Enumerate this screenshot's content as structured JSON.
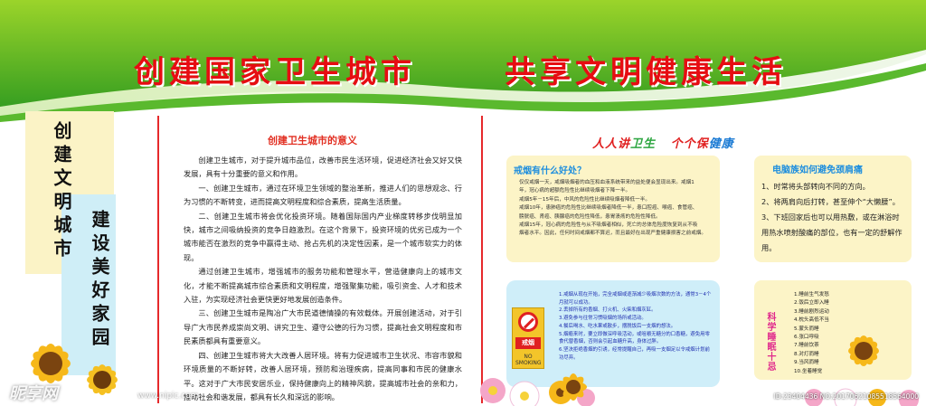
{
  "header": {
    "headline_left": "创建国家卫生城市",
    "headline_right": "共享文明健康生活"
  },
  "left_banner": {
    "col1": "创建文明城市",
    "col2": "建设美好家园"
  },
  "meaning": {
    "title": "创建卫生城市的意义",
    "paragraphs": [
      "创建卫生城市，对于提升城市品位，改善市民生活环境，促进经济社会又好又快发展，具有十分重要的意义和作用。",
      "一、创建卫生城市，通过在环境卫生领域的整治革新，推进人们的思想观念、行为习惯的不断转变，进而提高文明程度和综合素质，提高生活质量。",
      "二、创建卫生城市将会优化投资环境。随着国际国内产业梯度转移步伐明显加快，城市之间吸纳投资的竞争日趋激烈。在这个背景下，投资环境的优劣已成为一个城市能否在激烈的竞争中赢得主动、抢占先机的决定性因素，是一个城市软实力的体现。",
      "通过创建卫生城市，增强城市的服务功能和管理水平，营造健康向上的城市文化，才能不断提高城市综合素质和文明程度，增强聚集功能，吸引资金、人才和技术入驻，为实现经济社会更快更好地发展创造条件。",
      "三、创建卫生城市是陶冶广大市民道德情操的有效载体。开展创建活动，对于引导广大市民养成崇尚文明、讲究卫生、遵守公德的行为习惯，提高社会文明程度和市民素质都具有重要意义。",
      "四、创建卫生城市将大大改善人居环境。将有力促进城市卫生状况、市容市貌和环境质量的不断好转，改善人居环境，预防和治理疾病，提高同事和市民的健康水平。这对于广大市民安居乐业，保持健康向上的精神风貌，提高城市社会的亲和力，推动社会和谐发展，都具有长久和深远的影响。"
    ]
  },
  "slogan": {
    "part1": "人人讲",
    "part2": "卫生",
    "part3": "个个保",
    "part4": "健康"
  },
  "quit_smoking": {
    "title": "戒烟有什么好处？",
    "lines": [
      "仅仅戒烟一天，戒烟吸烟者的血压和血液系统带来的益处便会显现出来。戒烟1",
      "年，冠心病的超额危险性比继续吸烟者下降一半。",
      "戒烟5年－15年后，中风的危险性比继续吸烟者降低一半。",
      "戒烟10年，患肺癌的危险性比继续吸烟者降低一半，患口腔癌、喉癌、食管癌、",
      "膀胱癌、肾癌、胰腺癌的危险性降低，患胃溃疡的危险性降低。",
      "戒烟15年，冠心病的危险性与从不吸烟者相似，死亡的总体危险度恢复到从不吸",
      "烟者水平。因此，任何时间戒烟都不算迟，而且最好在出现严重健康损害之前戒烟。"
    ]
  },
  "neck_care": {
    "title": "电脑族如何避免颈肩痛",
    "items": [
      "1、时常将头部转向不同的方向。",
      "2、将两肩向后打转，甚至伸个“大懒腰”。",
      "3、下班回家后也可以用热敷，或在淋浴时用热水喷射酸痛的部位，也有一定的舒解作用。"
    ]
  },
  "quit_methods": {
    "lines": [
      "1.戒烟从现在开始，完全戒烟或逐渐减少吸烟次数的方法，通常3－4个月就可以成功。",
      "2.丢掉所有的香烟、打火机、火柴和烟灰缸。",
      "3.避免参与往常习惯吸烟的场所或活动。",
      "4.餐后喝水、吃水果或散步，摆脱饭后一支烟的想法。",
      "5.烟瘾来时，要立即做深呼吸活动，或咀嚼无糖分的口香糖，避免用零食代替香烟，否则会引起血糖升高，身体过胖。",
      "6.坚决拒绝香烟的引诱，经常提醒自己，再吸一支烟足以令戒烟计划前功尽弃。"
    ],
    "badge_label": "戒烟",
    "badge_sub": "NO SMOKING"
  },
  "sleep": {
    "head": "科学睡眠十忌",
    "items": [
      "1.睡前生气发怒",
      "2.饭后立即入睡",
      "3.睡前剧烈运动",
      "4.枕头高低不当",
      "5.蒙头而睡",
      "6.张口呼吸",
      "7.睡前饮茶",
      "8.对灯而睡",
      "9.当风而睡",
      "10.坐着睡觉"
    ]
  },
  "watermarks": {
    "logo": "昵享网",
    "url": "www.nipic.com",
    "id_line": "ID:23404436 NO:20170621085518564000"
  },
  "colors": {
    "headline": "#e60d12",
    "green": "#3aa935",
    "title_blue": "#1d8ede"
  }
}
